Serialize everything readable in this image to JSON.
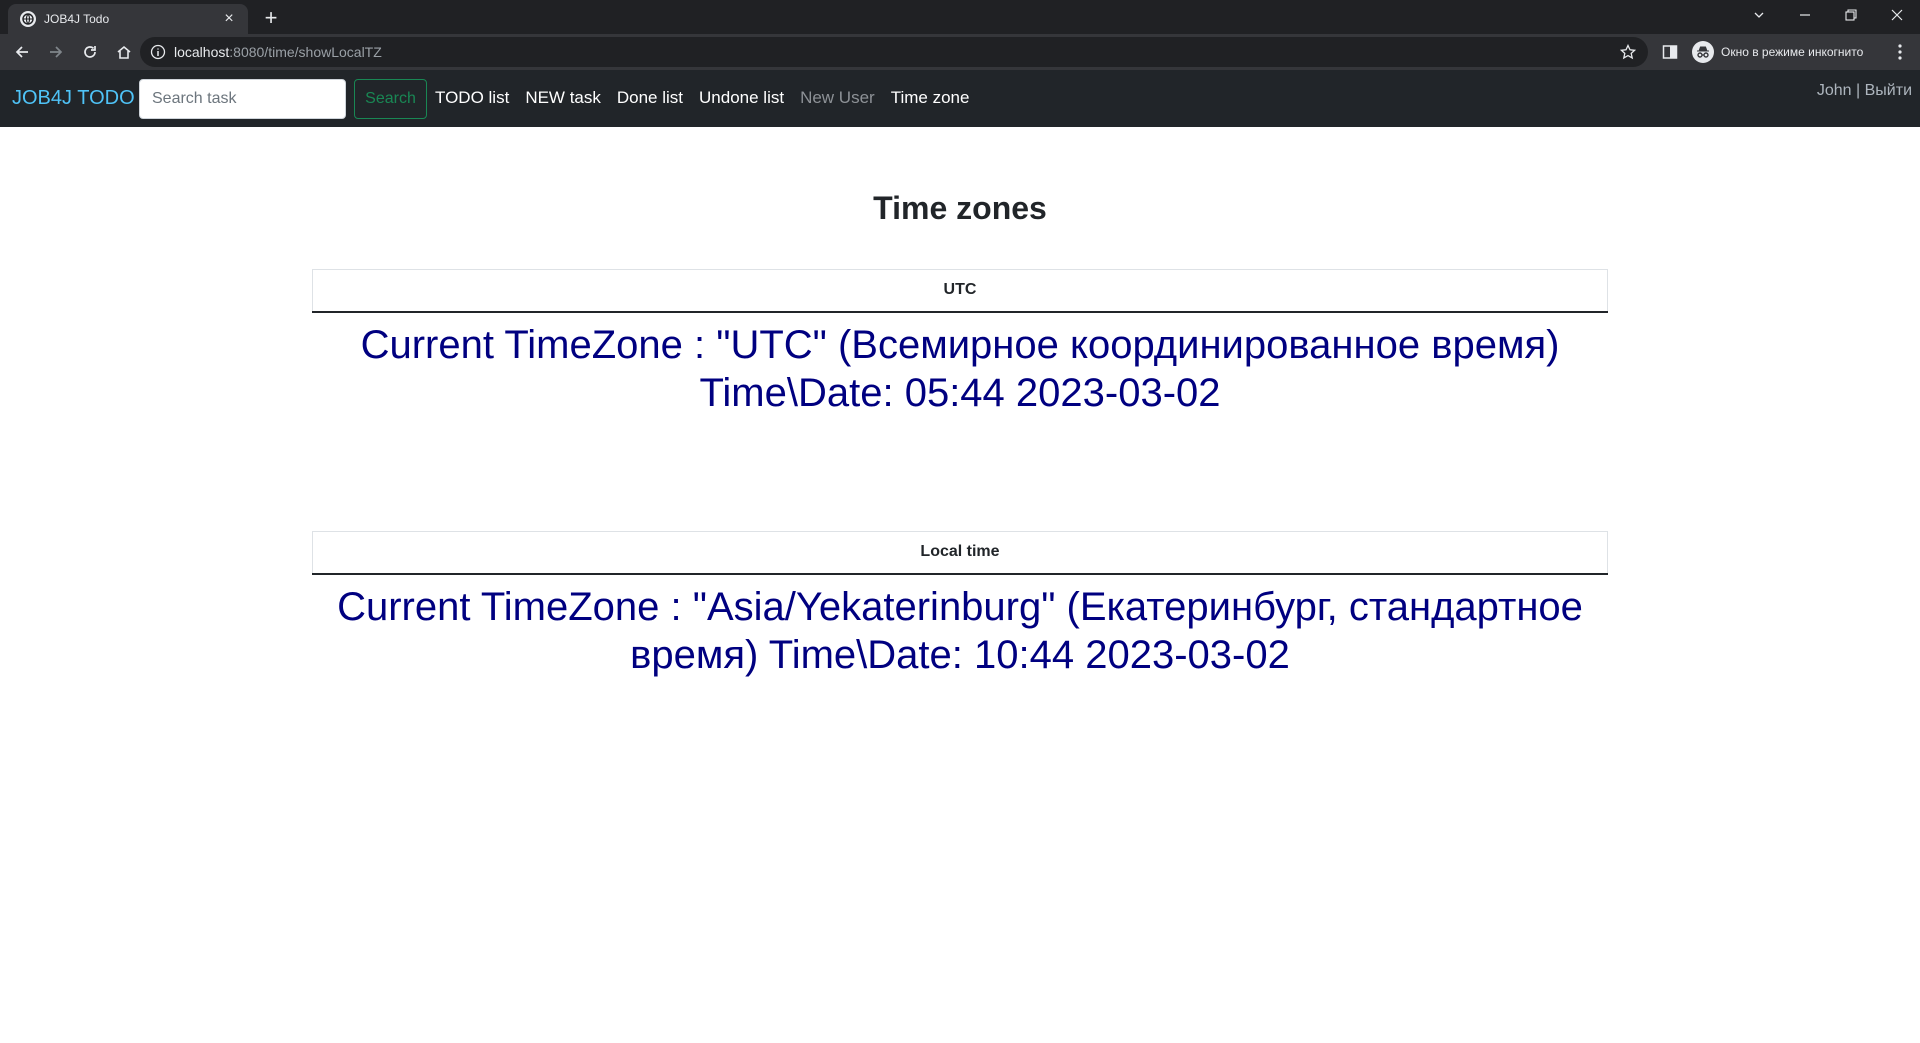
{
  "browser": {
    "tab": {
      "title": "JOB4J Todo",
      "close": "×"
    },
    "new_tab": "+",
    "url": {
      "host": "localhost",
      "rest": ":8080/time/showLocalTZ"
    },
    "incognito_label": "Окно в режиме инкогнито"
  },
  "navbar": {
    "brand": "JOB4J TODO",
    "search_placeholder": "Search task",
    "search_button": "Search",
    "links": [
      {
        "label": "TODO list",
        "enabled": true
      },
      {
        "label": "NEW task",
        "enabled": true
      },
      {
        "label": "Done list",
        "enabled": true
      },
      {
        "label": "Undone list",
        "enabled": true
      },
      {
        "label": "New User",
        "enabled": false
      },
      {
        "label": "Time zone",
        "enabled": true
      }
    ],
    "user": "John",
    "separator": "|",
    "logout": "Выйти"
  },
  "page": {
    "title": "Time zones",
    "utc": {
      "header": "UTC",
      "text": "Current TimeZone : \"UTC\" (Всемирное координированное время) Time\\Date: 05:44 2023-03-02"
    },
    "local": {
      "header": "Local time",
      "text": "Current TimeZone : \"Asia/Yekaterinburg\" (Екатеринбург, стандартное время) Time\\Date: 10:44 2023-03-02"
    }
  },
  "colors": {
    "navbar_bg": "#212529",
    "brand": "#4fc3f7",
    "search_button": "#198754",
    "timezone_text": "#000080"
  }
}
